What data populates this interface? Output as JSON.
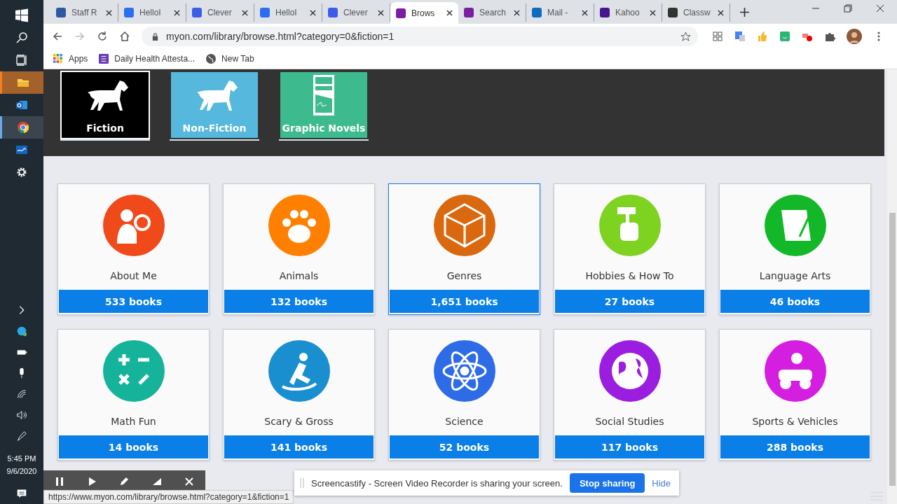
{
  "taskbar": {
    "time": "5:45 PM",
    "date": "9/6/2020"
  },
  "tabs": [
    {
      "title": "Staff R",
      "selected": false
    },
    {
      "title": "HelloI",
      "selected": false
    },
    {
      "title": "Clever",
      "selected": false
    },
    {
      "title": "HelloI",
      "selected": false
    },
    {
      "title": "Clever",
      "selected": false
    },
    {
      "title": "Brows",
      "selected": true
    },
    {
      "title": "Search",
      "selected": false
    },
    {
      "title": "Mail -",
      "selected": false
    },
    {
      "title": "Kahoo",
      "selected": false
    },
    {
      "title": "Classw",
      "selected": false
    }
  ],
  "address": "myon.com/library/browse.html?category=0&fiction=1",
  "bookmarks": [
    "Apps",
    "Daily Health Attesta...",
    "New Tab"
  ],
  "formats": [
    {
      "label": "Fiction",
      "color": "#000000",
      "selected": true
    },
    {
      "label": "Non-Fiction",
      "color": "#56b8dc",
      "selected": false
    },
    {
      "label": "Graphic Novels",
      "color": "#3dbb8e",
      "selected": false
    }
  ],
  "categories": [
    {
      "name": "About Me",
      "count": "533 books",
      "color": "#f04a1a",
      "highlighted": false
    },
    {
      "name": "Animals",
      "count": "132 books",
      "color": "#ff8000",
      "highlighted": false
    },
    {
      "name": "Genres",
      "count": "1,651 books",
      "color": "#d9680f",
      "highlighted": true
    },
    {
      "name": "Hobbies & How To",
      "count": "27 books",
      "color": "#7ed321",
      "highlighted": false
    },
    {
      "name": "Language Arts",
      "count": "46 books",
      "color": "#13b828",
      "highlighted": false
    },
    {
      "name": "Math Fun",
      "count": "14 books",
      "color": "#16b39b",
      "highlighted": false
    },
    {
      "name": "Scary & Gross",
      "count": "141 books",
      "color": "#1a8fd0",
      "highlighted": false
    },
    {
      "name": "Science",
      "count": "52 books",
      "color": "#2e6be6",
      "highlighted": false
    },
    {
      "name": "Social Studies",
      "count": "117 books",
      "color": "#9b1de0",
      "highlighted": false
    },
    {
      "name": "Sports & Vehicles",
      "count": "288 books",
      "color": "#d41ee0",
      "highlighted": false
    }
  ],
  "status_url": "https://www.myon.com/library/browse.html?category=1&fiction=1",
  "share_bar": {
    "message": "Screencastify - Screen Video Recorder is sharing your screen.",
    "stop": "Stop sharing",
    "hide": "Hide"
  }
}
